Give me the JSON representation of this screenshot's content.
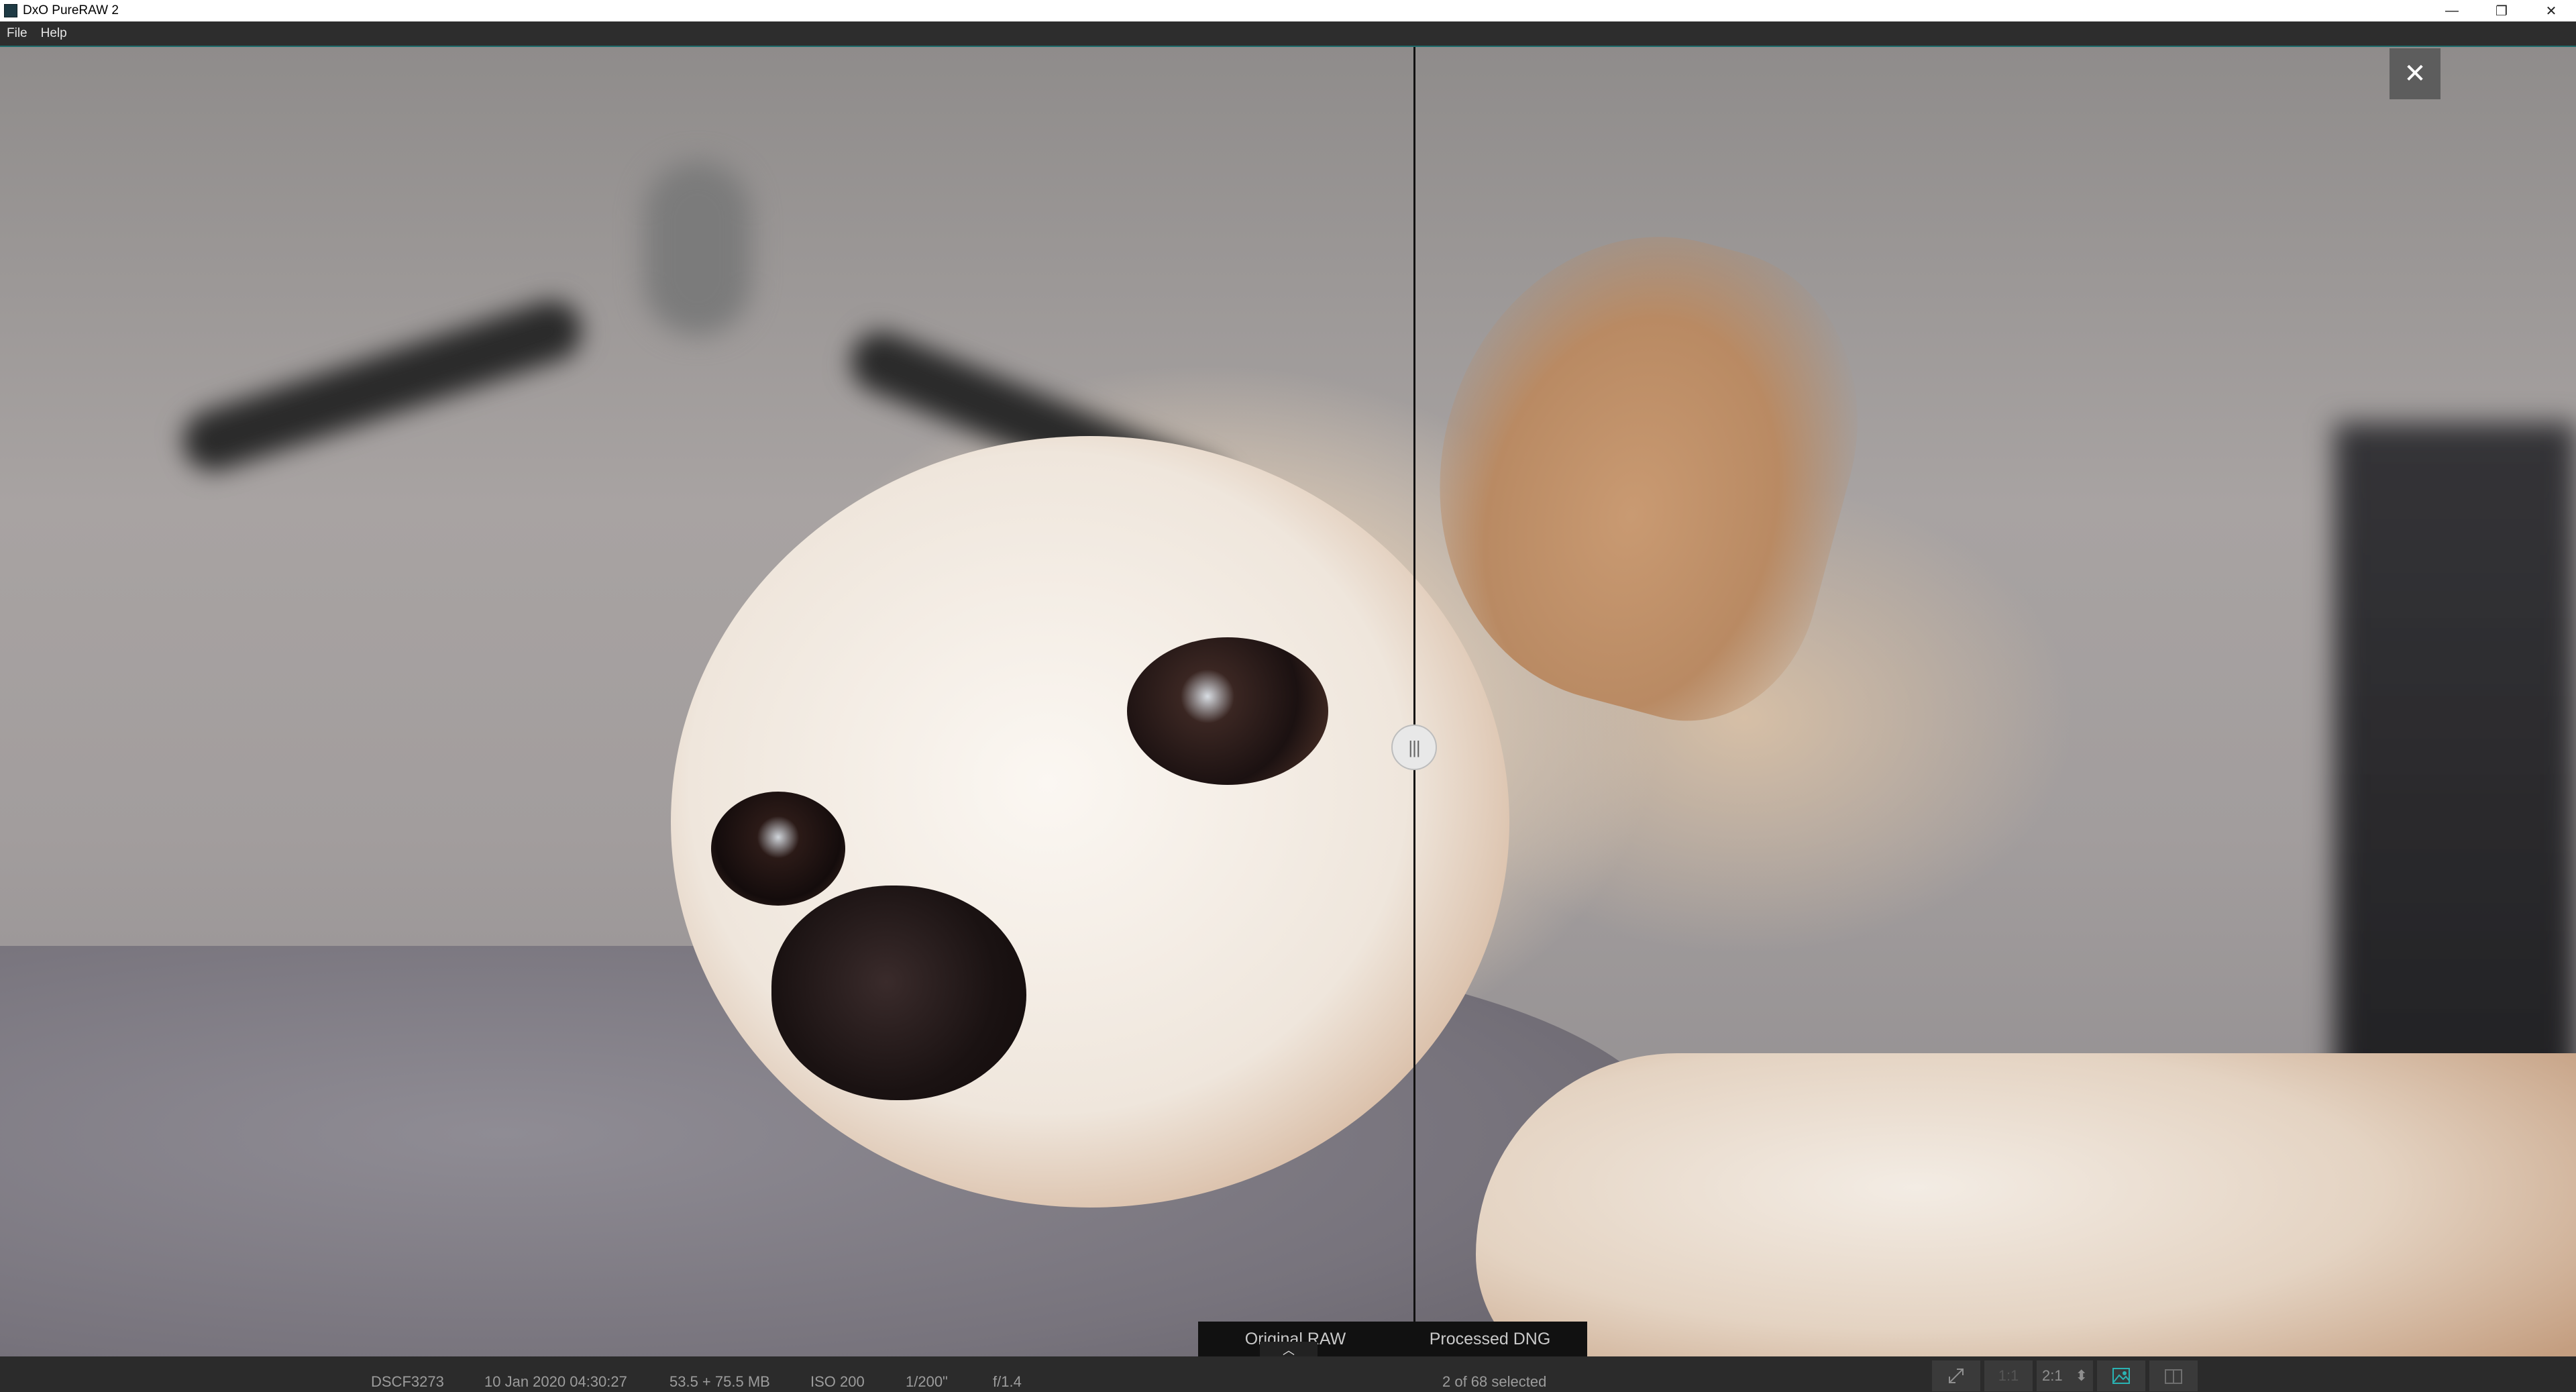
{
  "app": {
    "title": "DxO PureRAW 2"
  },
  "window_controls": {
    "minimize": "—",
    "restore": "❐",
    "close": "✕"
  },
  "menu": {
    "items": [
      "File",
      "Help"
    ]
  },
  "viewer": {
    "split_handle_glyph": "|||",
    "close_glyph": "✕",
    "compare": {
      "left_label": "Original RAW",
      "right_label": "Processed DNG",
      "toggle_glyph": "︿"
    }
  },
  "status": {
    "filename": "DSCF3273",
    "datetime": "10 Jan 2020 04:30:27",
    "filesize": "53.5 + 75.5 MB",
    "iso": "ISO 200",
    "shutter": "1/200\"",
    "aperture": "f/1.4",
    "selection": "2 of 68 selected"
  },
  "toolbar": {
    "fit_icon": "fit-to-screen-icon",
    "zoom_1_1": "1:1",
    "zoom_2_1": "2:1",
    "zoom_stepper_glyph": "⬍",
    "single_view_icon": "single-image-view-icon",
    "compare_view_icon": "side-by-side-view-icon"
  }
}
